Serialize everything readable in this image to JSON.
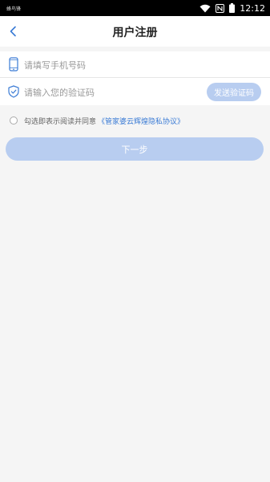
{
  "status_bar": {
    "left_text": "蜂鸟锋",
    "time": "12:12",
    "icons": [
      "wifi-icon",
      "nfc-icon",
      "battery-icon"
    ]
  },
  "header": {
    "title": "用户注册",
    "back_icon": "chevron-left-icon"
  },
  "form": {
    "phone": {
      "icon": "phone-icon",
      "placeholder": "请填写手机号码",
      "value": ""
    },
    "code": {
      "icon": "shield-check-icon",
      "placeholder": "请输入您的验证码",
      "value": "",
      "send_button_label": "发送验证码"
    }
  },
  "agreement": {
    "text": "勾选即表示阅读并同意",
    "link_text": "《管家婆云辉煌隐私协议》",
    "checked": false
  },
  "next_button_label": "下一步",
  "colors": {
    "accent": "#3a7bd5",
    "button_disabled": "#b8cdf0",
    "background": "#f5f5f5"
  }
}
